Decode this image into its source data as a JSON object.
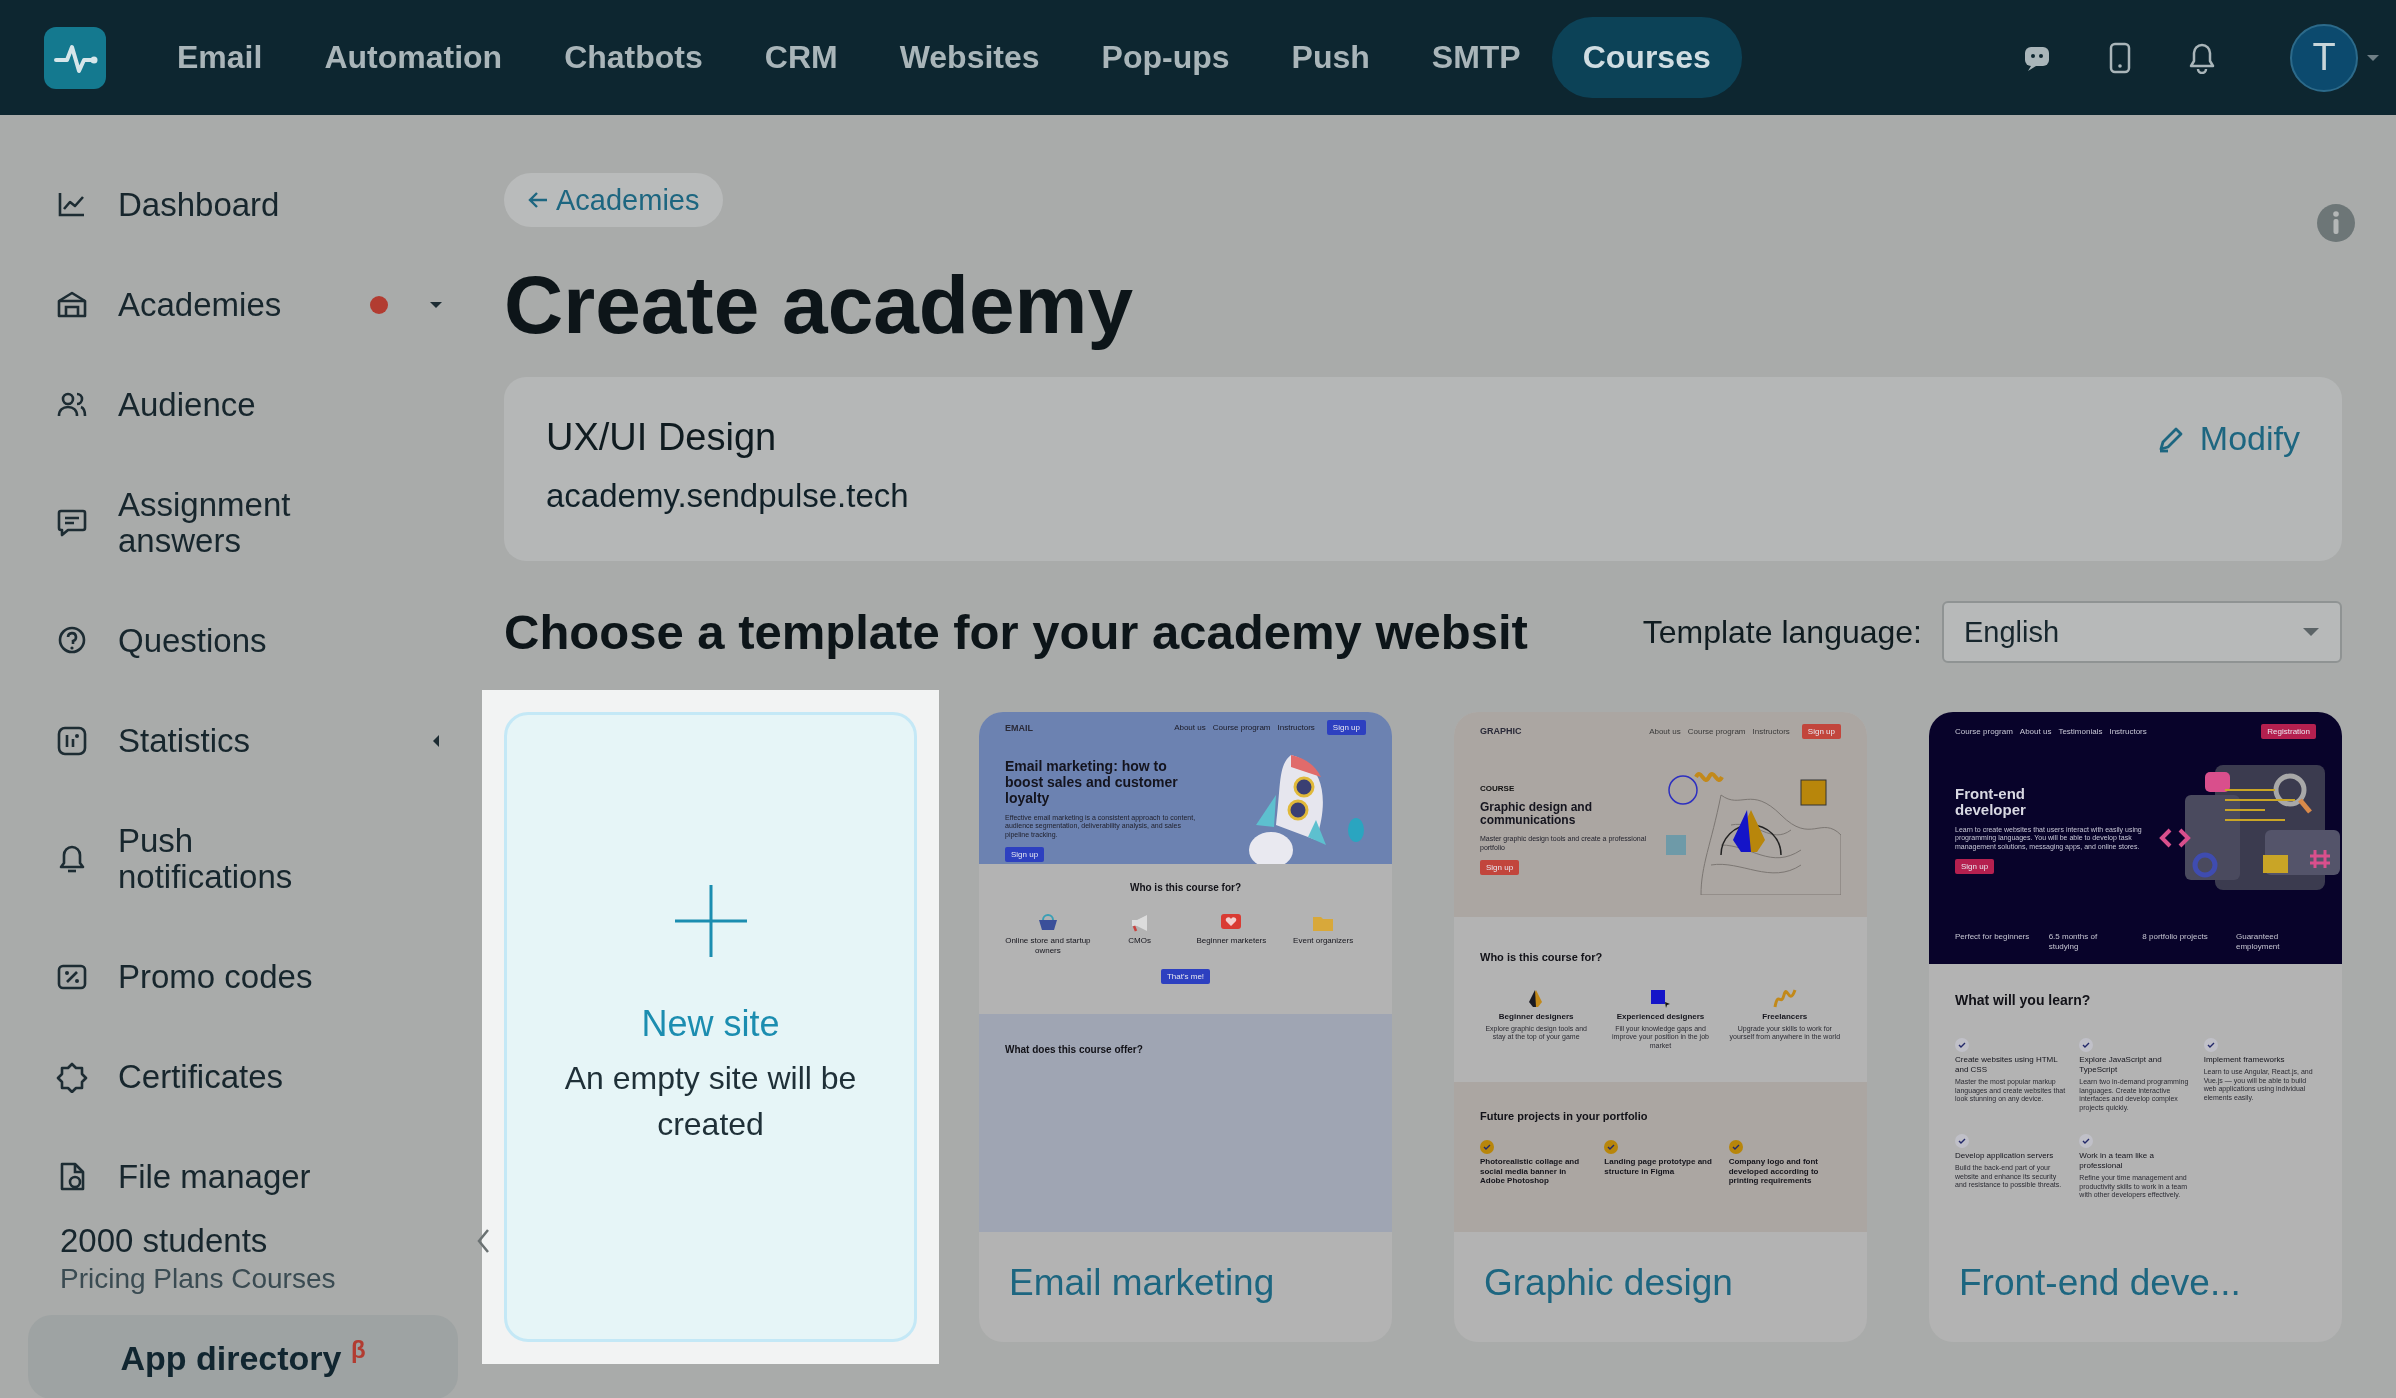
{
  "topbar": {
    "logo_initial": "T",
    "nav": [
      {
        "label": "Email",
        "selected": false
      },
      {
        "label": "Automation",
        "selected": false
      },
      {
        "label": "Chatbots",
        "selected": false
      },
      {
        "label": "CRM",
        "selected": false
      },
      {
        "label": "Websites",
        "selected": false
      },
      {
        "label": "Pop-ups",
        "selected": false
      },
      {
        "label": "Push",
        "selected": false
      },
      {
        "label": "SMTP",
        "selected": false
      },
      {
        "label": "Courses",
        "selected": true
      }
    ]
  },
  "sidebar": {
    "items": [
      {
        "label": "Dashboard",
        "kind": "link"
      },
      {
        "label": "Academies",
        "kind": "group",
        "expanded": true,
        "alert": true
      },
      {
        "label": "Audience",
        "kind": "link"
      },
      {
        "label": "Assignment answers",
        "kind": "link"
      },
      {
        "label": "Questions",
        "kind": "link"
      },
      {
        "label": "Statistics",
        "kind": "group",
        "expanded": false,
        "alert": false
      },
      {
        "label": "Push notifications",
        "kind": "link"
      },
      {
        "label": "Promo codes",
        "kind": "link"
      },
      {
        "label": "Certificates",
        "kind": "link"
      },
      {
        "label": "File manager",
        "kind": "link"
      }
    ],
    "plan": {
      "count": "2000 students",
      "name": "Pricing Plans Courses"
    },
    "app_directory": "App directory $^{β}$"
  },
  "main": {
    "back_link": "Academies",
    "title": "Create academy",
    "academy": {
      "name": "UX/UI Design",
      "domain": "academy.sendpulse.tech",
      "action": "Modify"
    },
    "templates_heading": "Choose a template for your academy websit",
    "language": {
      "label": "Template language:",
      "value": "English"
    },
    "templates": [
      {
        "kind": "new",
        "selected": true,
        "title": "New site",
        "subtitle": "An empty site will be created"
      },
      {
        "kind": "template",
        "selected": false,
        "name": "Email marketing",
        "preview": {
          "kind": "email",
          "logo": "EMAIL",
          "nav": [
            "About us",
            "Course program",
            "Instructors"
          ],
          "nav_button": "Sign up",
          "headline": "Email marketing: how to boost sales and customer loyalty",
          "description": "Effective email marketing is a consistent approach to content, audience segmentation, deliverability analysis, and sales pipeline tracking.",
          "cta": "Sign up",
          "sections": [
            {
              "title": "Who is this course for?",
              "kind": "icons",
              "items": [
                {
                  "title": "Online store and startup owners"
                },
                {
                  "title": "CMOs"
                },
                {
                  "title": "Beginner marketers"
                },
                {
                  "title": "Event organizers"
                }
              ],
              "button": "That's me!"
            },
            {
              "title": "What does this course offer?",
              "kind": "plain"
            }
          ]
        }
      },
      {
        "kind": "template",
        "selected": false,
        "name": "Graphic design",
        "preview": {
          "kind": "graphic",
          "logo": "GRAPHIC",
          "nav": [
            "About us",
            "Course program",
            "Instructors"
          ],
          "nav_button": "Sign up",
          "eyebrow": "COURSE",
          "headline": "Graphic design and communications",
          "description": "Master graphic design tools and create a professional portfolio",
          "cta": "Sign up",
          "sections": [
            {
              "title": "Who is this course for?",
              "kind": "icons",
              "items": [
                {
                  "title": "Beginner designers",
                  "text": "Explore graphic design tools and stay at the top of your game"
                },
                {
                  "title": "Experienced designers",
                  "text": "Fill your knowledge gaps and improve your position in the job market"
                },
                {
                  "title": "Freelancers",
                  "text": "Upgrade your skills to work for yourself from anywhere in the world"
                }
              ]
            },
            {
              "title": "Future projects in your portfolio",
              "kind": "checks",
              "items": [
                {
                  "title": "Photorealistic collage and social media banner in Adobe Photoshop"
                },
                {
                  "title": "Landing page prototype and structure in Figma"
                },
                {
                  "title": "Company logo and font developed according to printing requirements"
                }
              ]
            }
          ]
        }
      },
      {
        "kind": "template",
        "selected": false,
        "name": "Front-end deve...",
        "preview": {
          "kind": "frontend",
          "nav": [
            "Course program",
            "About us",
            "Testimonials",
            "Instructors"
          ],
          "nav_button": "Registration",
          "headline": "Front-end developer",
          "description": "Learn to create websites that users interact with easily using programming languages. You will be able to develop task management solutions, messaging apps, and online stores.",
          "cta": "Sign up",
          "stats": [
            "Perfect for beginners",
            "6.5 months of studying",
            "8 portfolio projects",
            "Guaranteed employment"
          ],
          "sections": [
            {
              "title": "What will you learn?",
              "kind": "checks",
              "items": [
                {
                  "title": "Create websites using HTML and CSS",
                  "text": "Master the most popular markup languages and create websites that look stunning on any device."
                },
                {
                  "title": "Explore JavaScript and TypeScript",
                  "text": "Learn two in-demand programming languages. Create interactive interfaces and develop complex projects quickly."
                },
                {
                  "title": "Implement frameworks",
                  "text": "Learn to use Angular, React.js, and Vue.js — you will be able to build web applications using individual elements easily."
                },
                {
                  "title": "Develop application servers",
                  "text": "Build the back-end part of your website and enhance its security and resistance to possible threats."
                },
                {
                  "title": "Work in a team like a professional",
                  "text": "Refine your time management and productivity skills to work in a team with other developers effectively."
                }
              ]
            }
          ]
        }
      }
    ]
  }
}
